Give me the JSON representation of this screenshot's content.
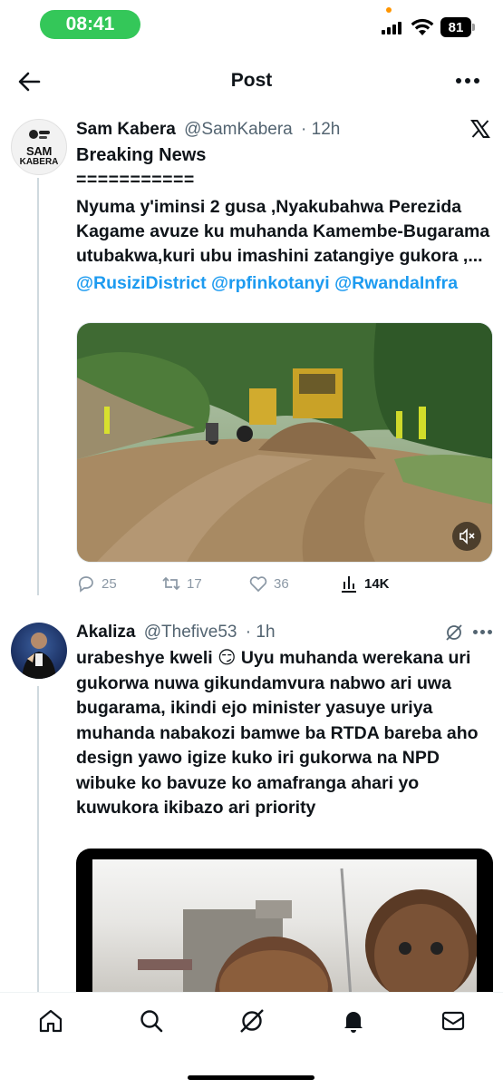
{
  "status_bar": {
    "time": "08:41",
    "battery": "81"
  },
  "header": {
    "title": "Post"
  },
  "posts": [
    {
      "name": "Sam Kabera",
      "handle": "@SamKabera",
      "time": "· 12h",
      "avatar_text": [
        "SAM",
        "KABERA"
      ],
      "lines": [
        "Breaking News",
        "===========",
        "Nyuma y'iminsi 2 gusa ,Nyakubahwa Perezida Kagame avuze ku muhanda Kamembe-Bugarama utubakwa,kuri ubu imashini zatangiye gukora ,..."
      ],
      "mentions": [
        "@RusiziDistrict",
        "@rpfinkotanyi",
        "@RwandaInfra"
      ],
      "stats": {
        "replies": "25",
        "reposts": "17",
        "likes": "36",
        "views": "14K"
      }
    },
    {
      "name": "Akaliza",
      "handle": "@Thefive53",
      "time": "· 1h",
      "text": "urabeshye kweli 😏 Uyu muhanda werekana uri gukorwa nuwa gikundamvura nabwo ari uwa bugarama, ikindi ejo minister yasuye uriya muhanda nabakozi bamwe ba RTDA bareba aho design yawo igize kuko iri gukorwa na NPD wibuke ko bavuze ko amafranga ahari yo kuwukora ikibazo ari priority"
    }
  ],
  "colors": {
    "accent": "#1d9bf0",
    "status_pill": "#34c759",
    "muted": "#536471"
  },
  "icons": [
    "back-arrow-icon",
    "more-icon",
    "x-logo-icon",
    "reply-icon",
    "repost-icon",
    "like-icon",
    "views-icon",
    "mute-icon",
    "grok-icon",
    "home-icon",
    "search-icon",
    "notifications-icon",
    "messages-icon"
  ]
}
